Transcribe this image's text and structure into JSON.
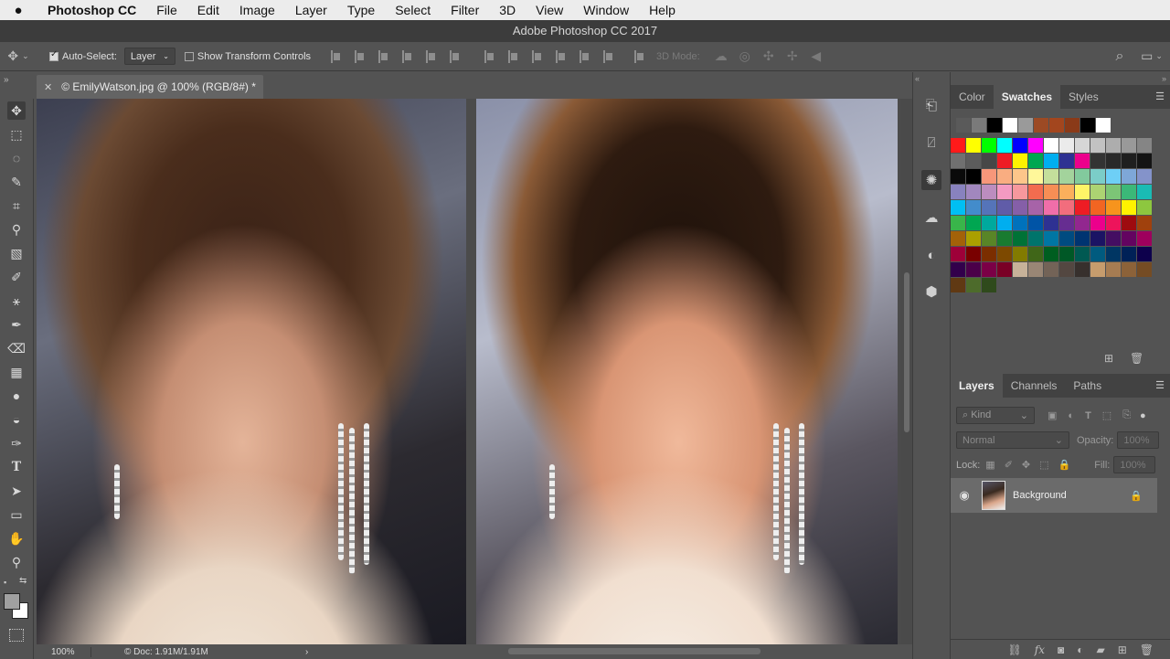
{
  "menubar": {
    "apple_icon": "apple-icon",
    "app_name": "Photoshop CC",
    "items": [
      "File",
      "Edit",
      "Image",
      "Layer",
      "Type",
      "Select",
      "Filter",
      "3D",
      "View",
      "Window",
      "Help"
    ]
  },
  "window": {
    "title": "Adobe Photoshop CC 2017"
  },
  "options_bar": {
    "auto_select_label": "Auto-Select:",
    "auto_select_checked": true,
    "auto_select_value": "Layer",
    "show_transform_label": "Show Transform Controls",
    "show_transform_checked": false,
    "mode_3d_label": "3D Mode:"
  },
  "document": {
    "tab_title": "© EmilyWatson.jpg @ 100% (RGB/8#) *",
    "close_icon": "close-icon"
  },
  "status": {
    "zoom": "100%",
    "doc_size": "Doc: 1.91M/1.91M"
  },
  "tools": [
    "move-tool",
    "marquee-tool",
    "lasso-tool",
    "quick-select-tool",
    "crop-tool",
    "eyedropper-tool",
    "healing-brush-tool",
    "brush-tool",
    "clone-stamp-tool",
    "history-brush-tool",
    "eraser-tool",
    "gradient-tool",
    "blur-tool",
    "dodge-tool",
    "pen-tool",
    "type-tool",
    "path-select-tool",
    "rectangle-tool",
    "hand-tool",
    "zoom-tool"
  ],
  "panels": {
    "color_tabs": [
      "Color",
      "Swatches",
      "Styles"
    ],
    "active_color_tab": "Swatches",
    "recent_swatches": [
      "#5a5a5a",
      "#7a7a7a",
      "#000000",
      "#ffffff",
      "#9a9a9a",
      "#9c4a24",
      "#a3461e",
      "#8a3a18",
      "#000000",
      "#ffffff"
    ],
    "swatches": [
      "#ff1a1a",
      "#ffff00",
      "#00ff00",
      "#00ffff",
      "#0000ff",
      "#ff00ff",
      "#ffffff",
      "#ebebeb",
      "#d6d6d6",
      "#c2c2c2",
      "#adadad",
      "#999999",
      "#858585",
      "#707070",
      "#5c5c5c",
      "#474747",
      "#ed1c24",
      "#fff200",
      "#00a651",
      "#00aeef",
      "#2e3192",
      "#ec008c",
      "#333333",
      "#292929",
      "#1f1f1f",
      "#141414",
      "#0a0a0a",
      "#000000",
      "#f7977a",
      "#f9ad81",
      "#fdc68a",
      "#fff79a",
      "#c4df9b",
      "#a3d39c",
      "#82ca9d",
      "#7bcdc8",
      "#6ecff6",
      "#7ea7d8",
      "#8493ca",
      "#8882be",
      "#a187be",
      "#bc8dbf",
      "#f49ac2",
      "#f6989d",
      "#f26c4f",
      "#f68e55",
      "#fbaf5c",
      "#fff467",
      "#acd372",
      "#7cc576",
      "#3bb878",
      "#1abbb4",
      "#00bff3",
      "#438ccb",
      "#5574b9",
      "#605ca8",
      "#855fa8",
      "#a763a8",
      "#f06ea9",
      "#f26d7d",
      "#ed1c24",
      "#f26522",
      "#f7941d",
      "#fff200",
      "#8dc73f",
      "#39b54a",
      "#00a651",
      "#00a99d",
      "#00aeef",
      "#0072bc",
      "#0054a6",
      "#2e3192",
      "#662d91",
      "#92278f",
      "#ec008c",
      "#ed145b",
      "#9e0b0f",
      "#a0410d",
      "#a36209",
      "#aba000",
      "#598527",
      "#197b30",
      "#007236",
      "#00746b",
      "#0076a3",
      "#004b80",
      "#003471",
      "#1b1464",
      "#440e62",
      "#630460",
      "#9e005d",
      "#9e0039",
      "#790000",
      "#7b2e00",
      "#7d4900",
      "#827b00",
      "#406618",
      "#005e20",
      "#005826",
      "#005952",
      "#005b7f",
      "#003663",
      "#002157",
      "#0d004c",
      "#32004b",
      "#4b0049",
      "#7b0046",
      "#7a0026",
      "#c7b299",
      "#998675",
      "#736357",
      "#534741",
      "#37302d",
      "#c69c6d",
      "#a67c52",
      "#8c6239",
      "#754c24",
      "#603913",
      "#4d6b2b",
      "#2f4a1c"
    ],
    "layer_tabs": [
      "Layers",
      "Channels",
      "Paths"
    ],
    "active_layer_tab": "Layers",
    "kind_label": "Kind",
    "blend_mode": "Normal",
    "opacity_label": "Opacity:",
    "opacity_value": "100%",
    "lock_label": "Lock:",
    "fill_label": "Fill:",
    "fill_value": "100%",
    "layers": [
      {
        "name": "Background",
        "visible": true,
        "locked": true
      }
    ]
  },
  "colors": {
    "foreground": "#a0a0a0",
    "background": "#ffffff"
  }
}
